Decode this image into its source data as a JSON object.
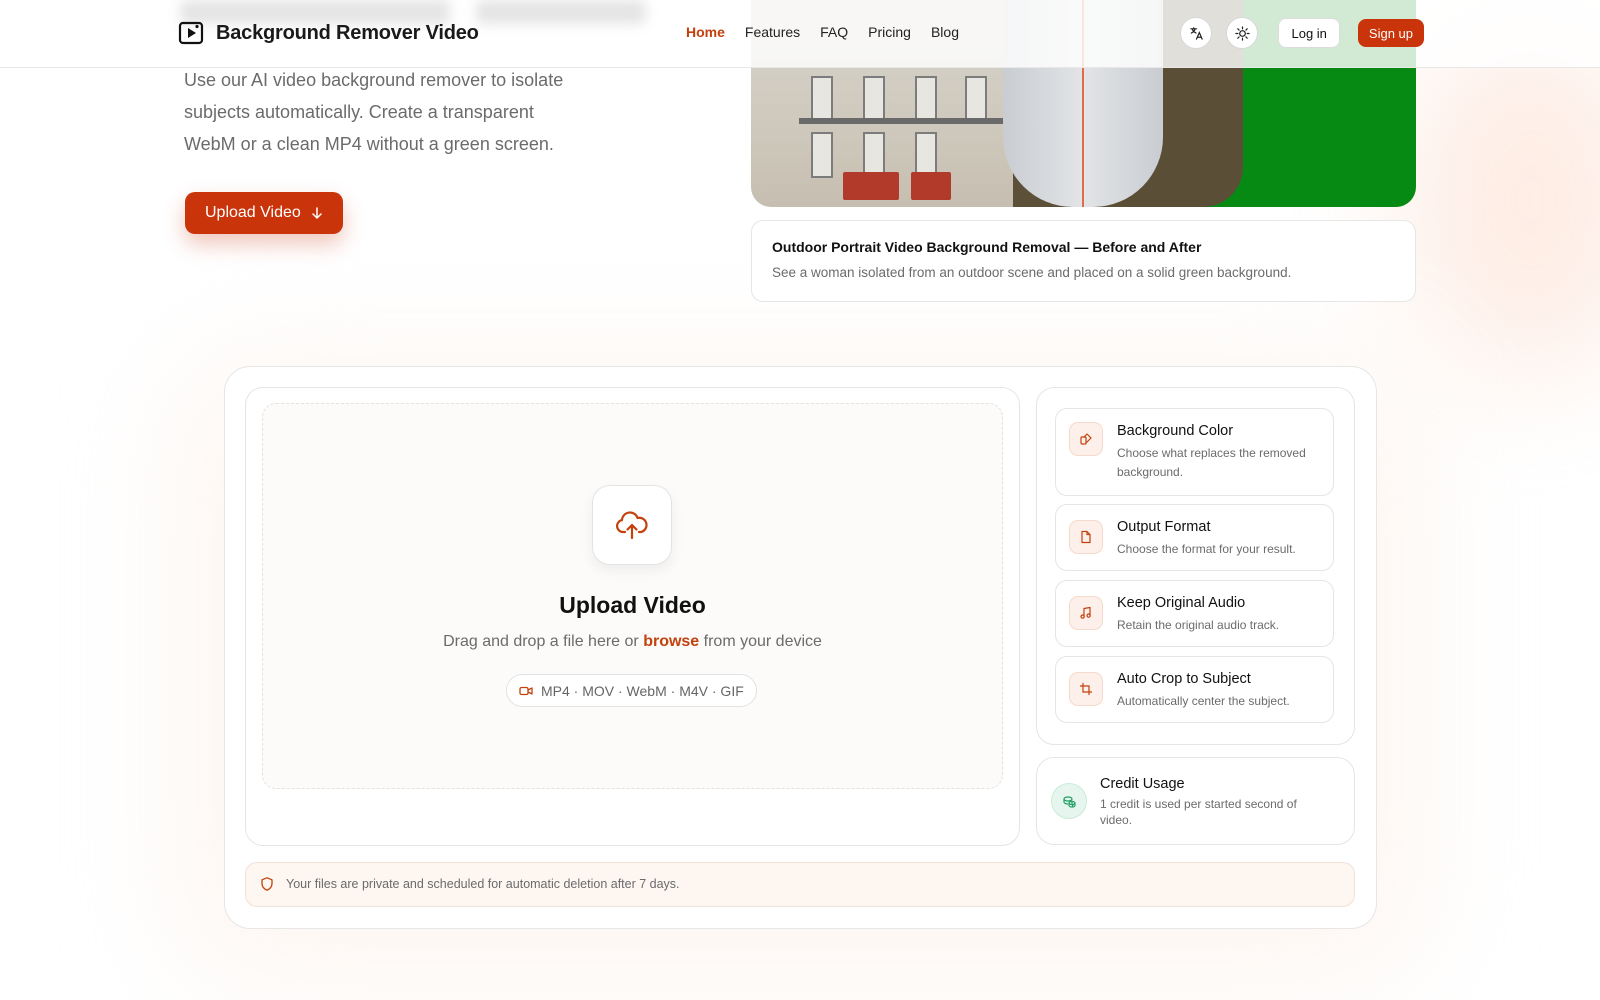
{
  "brand": {
    "name": "Background Remover Video"
  },
  "nav": {
    "items": [
      "Home",
      "Features",
      "FAQ",
      "Pricing",
      "Blog"
    ],
    "active": "Home"
  },
  "header": {
    "login_label": "Log in",
    "signup_label": "Sign up",
    "translate_icon": "translate-icon",
    "theme_icon": "sun-icon"
  },
  "hero": {
    "description": "Use our AI video background remover to isolate subjects automatically. Create a transparent WebM or a clean MP4 without a green screen.",
    "cta_label": "Upload Video"
  },
  "video": {
    "caption_title": "Outdoor Portrait Video Background Removal — Before and After",
    "caption_desc": "See a woman isolated from an outdoor scene and placed on a solid green background.",
    "after_color": "#078a14"
  },
  "upload": {
    "title": "Upload Video",
    "sub_prefix": "Drag and drop a file here or ",
    "sub_link": "browse",
    "sub_suffix": " from your device",
    "formats": "MP4 · MOV · WebM · M4V · GIF"
  },
  "options": [
    {
      "title": "Background Color",
      "desc": "Choose what replaces the removed background.",
      "icon": "palette-icon"
    },
    {
      "title": "Output Format",
      "desc": "Choose the format for your result.",
      "icon": "file-icon"
    },
    {
      "title": "Keep Original Audio",
      "desc": "Retain the original audio track.",
      "icon": "music-icon"
    },
    {
      "title": "Auto Crop to Subject",
      "desc": "Automatically center the subject.",
      "icon": "crop-icon"
    }
  ],
  "credit": {
    "title": "Credit Usage",
    "desc": "1 credit is used per started second of video.",
    "icon": "coins-icon"
  },
  "privacy": {
    "text": "Your files are private and scheduled for automatic deletion after 7 days.",
    "icon": "shield-icon"
  },
  "colors": {
    "accent": "#c9340a",
    "accent_text": "#c2410c",
    "credit_green": "#1f9d62"
  }
}
